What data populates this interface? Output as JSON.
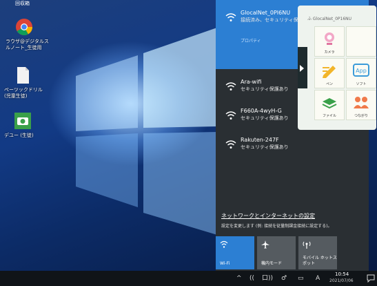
{
  "desktop": {
    "top_label": "回収箱",
    "icons": [
      {
        "label_lines": [
          "ラウザ@デジタルス",
          "ルノート_生徒用"
        ],
        "icon": "chrome-icon"
      },
      {
        "label_lines": [
          "ぺーツックドリル",
          "(児童生徒)"
        ],
        "icon": "document-icon"
      },
      {
        "label_lines": [
          "デユー (生徒)"
        ],
        "icon": "camera-app-icon"
      }
    ]
  },
  "network": {
    "connected": {
      "ssid": "GlocalNet_0PI6NU",
      "status": "接続済み、セキュリティ保",
      "properties": "プロパティ"
    },
    "networks": [
      {
        "ssid": "Ara-wifi",
        "status": "セキュリティ保護あり"
      },
      {
        "ssid": "F660A-4wyH-G",
        "status": "セキュリティ保護あり"
      },
      {
        "ssid": "Rakuten-247F",
        "status": "セキュリティ保護あり"
      }
    ],
    "settings_link": "ネットワークとインターネットの設定",
    "settings_desc": "設定を変更します (例: 接続を従量制課金接続に設定する)。",
    "tiles": [
      {
        "label": "Wi-Fi",
        "active": true,
        "icon": "wifi-icon"
      },
      {
        "label": "機内モード",
        "active": false,
        "icon": "airplane-icon"
      },
      {
        "label_lines": [
          "モバイル ホットス",
          "ポット"
        ],
        "active": false,
        "icon": "hotspot-icon"
      }
    ]
  },
  "launcher": {
    "tabs": "ふ   GlocalNet_0P16NU",
    "apps": [
      {
        "label": "カメラ",
        "icon": "webcam-icon"
      },
      {
        "label": "",
        "icon": "blank-icon"
      },
      {
        "label": "ペン",
        "icon": "pencil-icon"
      },
      {
        "label": "ソフト",
        "icon": "app-icon"
      },
      {
        "label": "ファイル",
        "icon": "stack-icon"
      },
      {
        "label": "つながり",
        "icon": "people-icon"
      }
    ]
  },
  "taskbar": {
    "tray": [
      "^",
      "((",
      "口))",
      "♂",
      "▭",
      "A"
    ],
    "time": "10:54",
    "date": "2021/07/06"
  },
  "colors": {
    "accent": "#2c7fd3",
    "tile_inactive": "#555b60",
    "flyout_bg": "#2a2f33"
  }
}
